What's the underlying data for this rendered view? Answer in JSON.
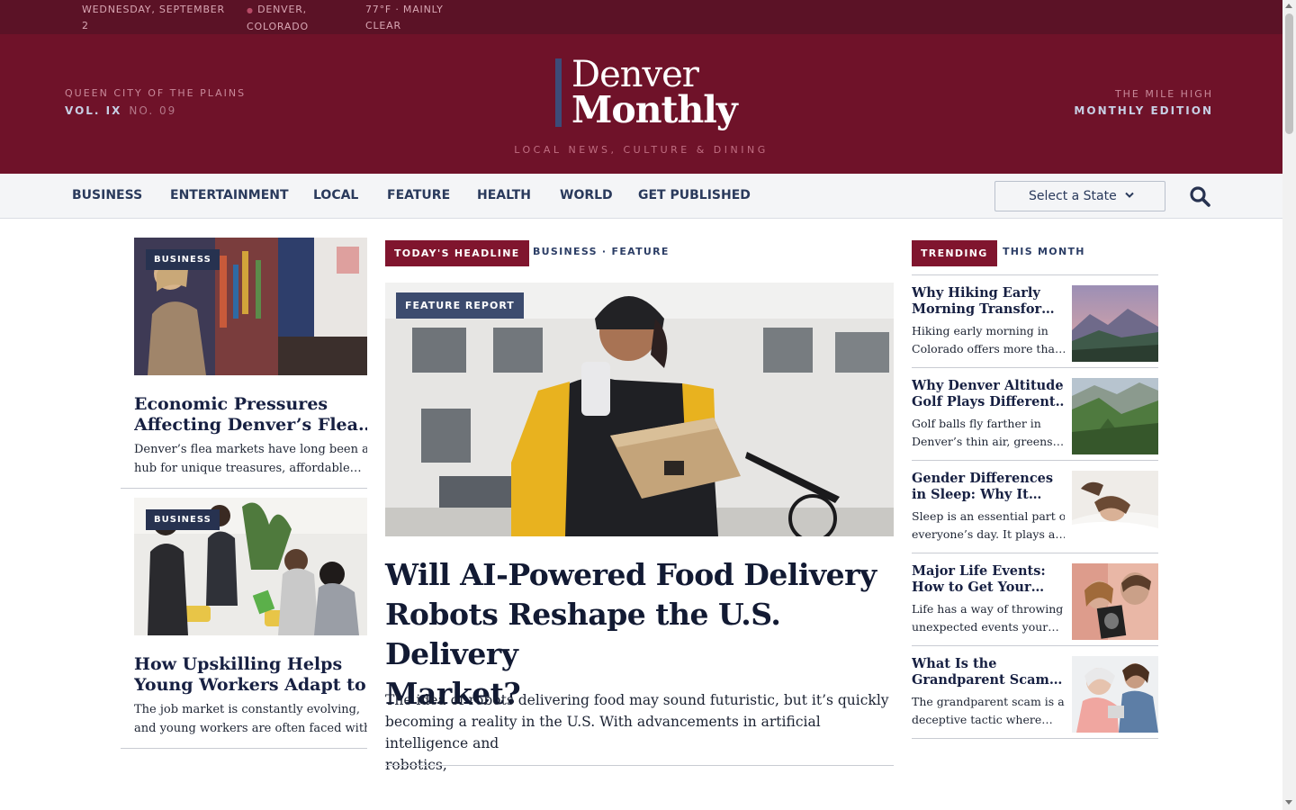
{
  "topbar": {
    "date": [
      "WEDNESDAY, SEPTEMBER",
      "2"
    ],
    "location": [
      "DENVER,",
      "COLORADO"
    ],
    "weather": [
      "77°F · MAINLY",
      "CLEAR"
    ]
  },
  "masthead": {
    "left_kicker": "QUEEN CITY OF THE PLAINS",
    "volume": "VOL. IX",
    "number": "NO. 09",
    "logo_line1": "Denver",
    "logo_line2": "Monthly",
    "tagline": "LOCAL NEWS, CULTURE & DINING",
    "right_kicker": "THE MILE HIGH",
    "right_edition": "MONTHLY EDITION"
  },
  "nav": {
    "items": [
      "BUSINESS",
      "ENTERTAINMENT",
      "LOCAL",
      "FEATURE",
      "HEALTH",
      "WORLD",
      "GET PUBLISHED"
    ],
    "state_select": "Select a State",
    "search_icon": "search-icon"
  },
  "left_articles": [
    {
      "badge": "BUSINESS",
      "title": "Economic Pressures Affecting Denver’s Flea…",
      "title_lines": [
        "Economic Pressures",
        "Affecting Denver’s Flea…"
      ],
      "excerpt_lines": [
        "Denver’s flea markets have long been a",
        "hub for unique treasures, affordable…"
      ]
    },
    {
      "badge": "BUSINESS",
      "title": "How Upskilling Helps Young Workers Adapt to…",
      "title_lines": [
        "How Upskilling Helps",
        "Young Workers Adapt to…"
      ],
      "excerpt_lines": [
        "The job market is constantly evolving,",
        "and young workers are often faced with…"
      ]
    }
  ],
  "main": {
    "headline_tag": "TODAY'S HEADLINE",
    "categories": "BUSINESS · FEATURE",
    "badge": "FEATURE REPORT",
    "headline_lines": [
      "Will AI-Powered Food Delivery",
      "Robots Reshape the U.S. Delivery",
      "Market?"
    ],
    "lede_lines": [
      "The idea of robots delivering food may sound futuristic, but it’s quickly",
      "becoming a reality in the U.S. With advancements in artificial intelligence and",
      "robotics,"
    ]
  },
  "trending": {
    "tag": "TRENDING",
    "period": "THIS MONTH",
    "items": [
      {
        "title_lines": [
          "Why Hiking Early",
          "Morning Transfor…"
        ],
        "excerpt_lines": [
          "Hiking early morning in",
          "Colorado offers more tha…"
        ]
      },
      {
        "title_lines": [
          "Why Denver Altitude",
          "Golf Plays Different…"
        ],
        "excerpt_lines": [
          "Golf balls fly farther in",
          "Denver’s thin air, greens…"
        ]
      },
      {
        "title_lines": [
          "Gender Differences",
          "in Sleep: Why It…"
        ],
        "excerpt_lines": [
          "Sleep is an essential part of",
          "everyone’s day. It plays a…"
        ]
      },
      {
        "title_lines": [
          "Major Life Events:",
          "How to Get Your…"
        ],
        "excerpt_lines": [
          "Life has a way of throwing",
          "unexpected events your…"
        ]
      },
      {
        "title_lines": [
          "What Is the",
          "Grandparent Scam…"
        ],
        "excerpt_lines": [
          "The grandparent scam is a",
          "deceptive tactic where…"
        ]
      }
    ]
  },
  "colors": {
    "topbar": "#5b1226",
    "masthead": "#6f1229",
    "accent_red": "#80152e",
    "navy": "#273250",
    "nav_text": "#2a3a5c"
  }
}
